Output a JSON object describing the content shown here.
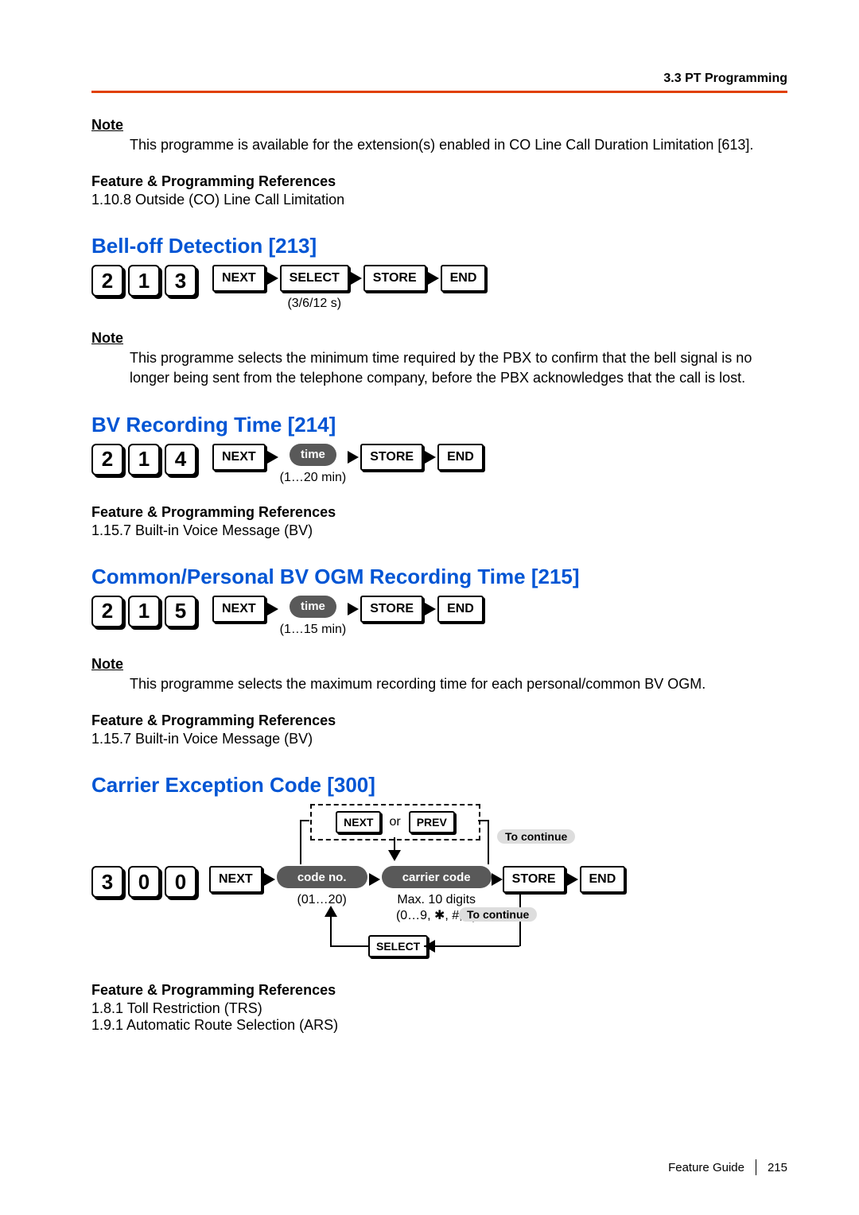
{
  "header": {
    "section": "3.3 PT Programming"
  },
  "intro": {
    "note_label": "Note",
    "note_text": "This programme is available for the extension(s) enabled in CO Line Call Duration Limitation [613].",
    "ref_label": "Feature & Programming References",
    "ref_text": "1.10.8 Outside (CO) Line Call Limitation"
  },
  "sec213": {
    "heading": "Bell-off Detection [213]",
    "digits": [
      "2",
      "1",
      "3"
    ],
    "steps": {
      "next": "NEXT",
      "select": "SELECT",
      "store": "STORE",
      "end": "END"
    },
    "select_sub": "(3/6/12 s)",
    "note_label": "Note",
    "note_text": "This programme selects the minimum time required by the PBX to confirm that the bell signal is no longer being sent from the telephone company, before the PBX acknowledges that the call is lost."
  },
  "sec214": {
    "heading": "BV Recording Time [214]",
    "digits": [
      "2",
      "1",
      "4"
    ],
    "steps": {
      "next": "NEXT",
      "time": "time",
      "store": "STORE",
      "end": "END"
    },
    "time_sub": "(1…20 min)",
    "ref_label": "Feature & Programming References",
    "ref_text": "1.15.7 Built-in Voice Message (BV)"
  },
  "sec215": {
    "heading": "Common/Personal BV OGM Recording Time [215]",
    "digits": [
      "2",
      "1",
      "5"
    ],
    "steps": {
      "next": "NEXT",
      "time": "time",
      "store": "STORE",
      "end": "END"
    },
    "time_sub": "(1…15 min)",
    "note_label": "Note",
    "note_text": "This programme selects the maximum recording time for each personal/common BV OGM.",
    "ref_label": "Feature & Programming References",
    "ref_text": "1.15.7 Built-in Voice Message (BV)"
  },
  "sec300": {
    "heading": "Carrier Exception Code [300]",
    "digits": [
      "3",
      "0",
      "0"
    ],
    "steps": {
      "next": "NEXT",
      "prev": "PREV",
      "or": "or",
      "code": "code no.",
      "carrier": "carrier code",
      "store": "STORE",
      "end": "END",
      "select": "SELECT"
    },
    "code_sub": "(01…20)",
    "carrier_sub1": "Max. 10 digits",
    "carrier_sub2": "(0…9, ✱, #, x)",
    "to_continue": "To continue",
    "ref_label": "Feature & Programming References",
    "ref1": "1.8.1 Toll Restriction (TRS)",
    "ref2": "1.9.1 Automatic Route Selection (ARS)"
  },
  "footer": {
    "guide": "Feature Guide",
    "page": "215"
  }
}
